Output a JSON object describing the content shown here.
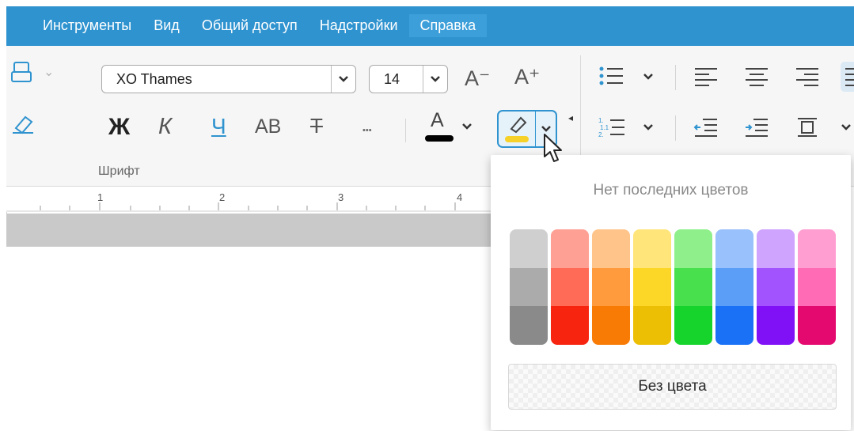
{
  "menu": [
    "Инструменты",
    "Вид",
    "Общий доступ",
    "Надстройки",
    "Справка"
  ],
  "font": {
    "name": "XO Thames",
    "size": "14",
    "decrease_label": "A⁻",
    "increase_label": "A⁺",
    "section_label": "Шрифт"
  },
  "format_buttons": {
    "bold": "Ж",
    "italic": "К",
    "underline": "Ч",
    "caps": "АВ",
    "strike": "Т",
    "more": "•••",
    "font_color": "A"
  },
  "ruler": {
    "ticks": [
      "1",
      "2",
      "3",
      "4"
    ]
  },
  "highlight_panel": {
    "title": "Нет последних цветов",
    "no_color_label": "Без цвета",
    "palette": [
      [
        "#cfcfcf",
        "#ababab",
        "#8a8a8a"
      ],
      [
        "#ffa095",
        "#ff6b57",
        "#f7240f"
      ],
      [
        "#ffc48a",
        "#ff9b3d",
        "#f87b06"
      ],
      [
        "#ffe57a",
        "#fcd728",
        "#edbf04"
      ],
      [
        "#8ff08b",
        "#49e04e",
        "#17d42d"
      ],
      [
        "#99c1fb",
        "#5b9ef8",
        "#1b71f6"
      ],
      [
        "#cfa4ff",
        "#a353fd",
        "#8011f6"
      ],
      [
        "#ff9ed1",
        "#ff6bb5",
        "#e4096f"
      ]
    ]
  },
  "colors": {
    "accent": "#2f93cf",
    "highlight_yellow": "#f5d12a"
  }
}
